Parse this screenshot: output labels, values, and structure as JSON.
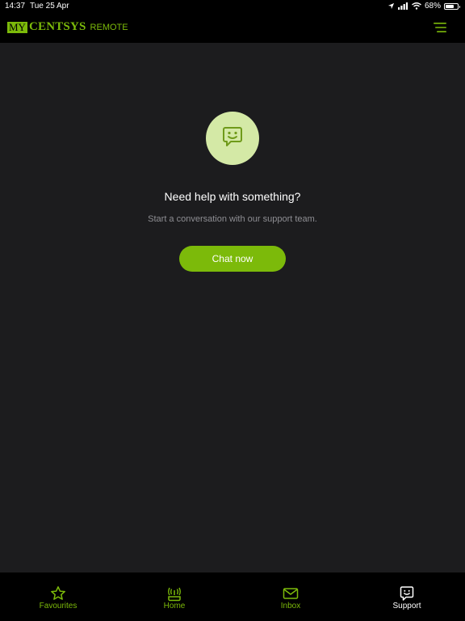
{
  "status_bar": {
    "time": "14:37",
    "date": "Tue 25 Apr",
    "battery": "68%",
    "battery_level": 0.68
  },
  "header": {
    "logo_my": "MY",
    "logo_brand": "CENTSYS",
    "logo_suffix": "REMOTE",
    "menu_icon": "hamburger-menu-icon"
  },
  "support": {
    "icon": "chat-bubble-smile-icon",
    "headline": "Need help with something?",
    "subtext": "Start a conversation with our support team.",
    "chat_button_label": "Chat now"
  },
  "tabs": [
    {
      "label": "Favourites",
      "icon": "star-icon",
      "active": false
    },
    {
      "label": "Home",
      "icon": "remote-signal-icon",
      "active": false
    },
    {
      "label": "Inbox",
      "icon": "envelope-icon",
      "active": false
    },
    {
      "label": "Support",
      "icon": "chat-bubble-smile-icon",
      "active": true
    }
  ],
  "colors": {
    "accent": "#7cba0a",
    "avatar_bg": "#d4e9a6",
    "content_bg": "#1c1c1e",
    "chrome_bg": "#000000"
  }
}
